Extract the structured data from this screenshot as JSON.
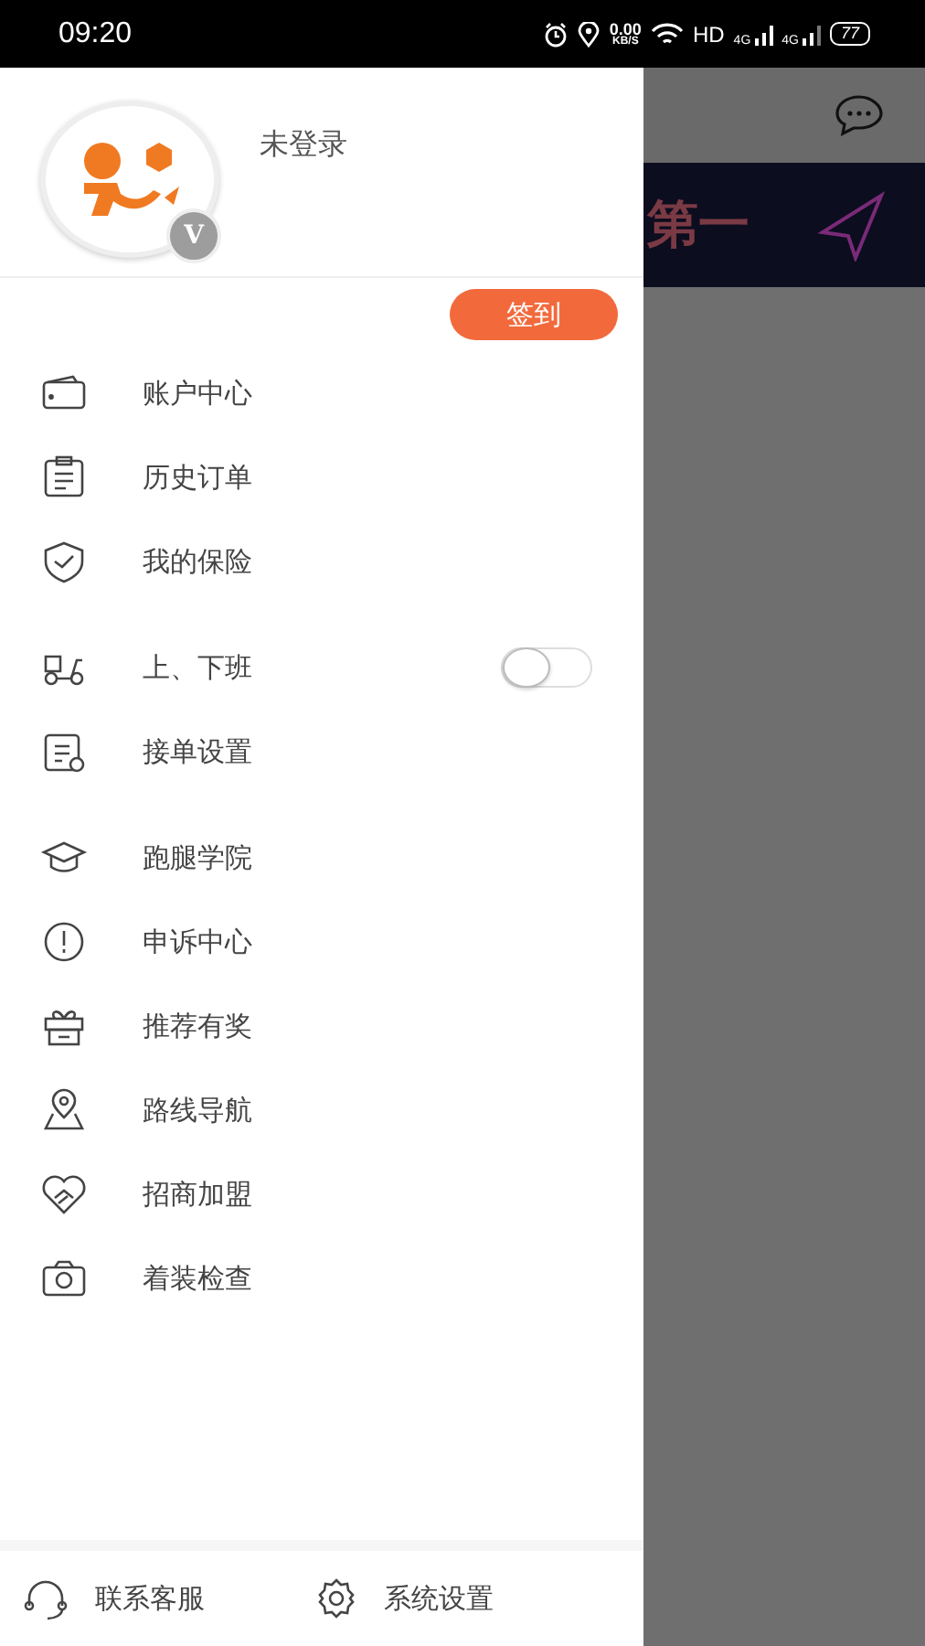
{
  "status_bar": {
    "time": "09:20",
    "speed": "0.00",
    "speed_unit": "KB/S",
    "hd": "HD",
    "net1": "4G",
    "net2": "4G",
    "battery": "77"
  },
  "background": {
    "banner_text": "第一"
  },
  "drawer": {
    "user": {
      "name": "未登录",
      "badge": "V"
    },
    "checkin_button": "签到",
    "groups": [
      [
        {
          "label": "账户中心",
          "kind": "link"
        },
        {
          "label": "历史订单",
          "kind": "link"
        },
        {
          "label": "我的保险",
          "kind": "link"
        }
      ],
      [
        {
          "label": "上、下班",
          "kind": "toggle",
          "on": false
        },
        {
          "label": "接单设置",
          "kind": "link"
        }
      ],
      [
        {
          "label": "跑腿学院",
          "kind": "link"
        },
        {
          "label": "申诉中心",
          "kind": "link"
        },
        {
          "label": "推荐有奖",
          "kind": "link"
        },
        {
          "label": "路线导航",
          "kind": "link"
        },
        {
          "label": "招商加盟",
          "kind": "link"
        },
        {
          "label": "着装检查",
          "kind": "link"
        }
      ]
    ],
    "footer": [
      "联系客服",
      "系统设置"
    ]
  }
}
